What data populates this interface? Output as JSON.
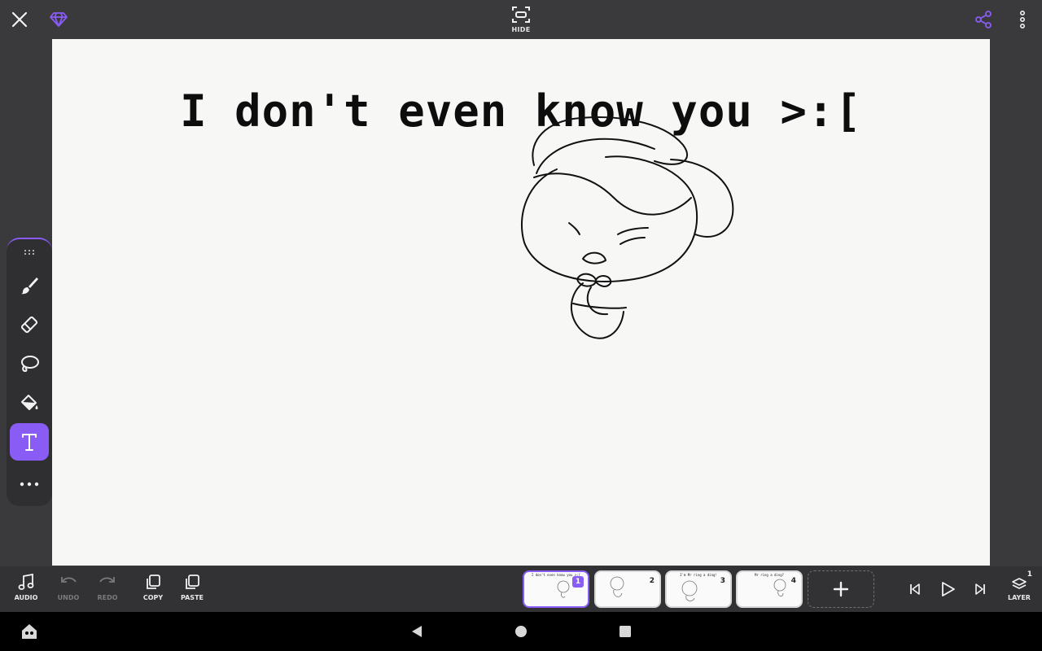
{
  "topbar": {
    "hide_label": "HIDE",
    "accent_color": "#8a5cf6"
  },
  "canvas": {
    "text": "I don't even know you >:["
  },
  "tools": {
    "items": [
      {
        "name": "brush",
        "icon": "brush-icon",
        "active": false
      },
      {
        "name": "eraser",
        "icon": "eraser-icon",
        "active": false
      },
      {
        "name": "lasso",
        "icon": "lasso-icon",
        "active": false
      },
      {
        "name": "fill",
        "icon": "fill-bucket-icon",
        "active": false
      },
      {
        "name": "text",
        "icon": "text-tool-icon",
        "active": true
      },
      {
        "name": "more",
        "icon": "more-horizontal-icon",
        "active": false
      }
    ]
  },
  "bottombar": {
    "audio_label": "AUDIO",
    "undo_label": "UNDO",
    "redo_label": "REDO",
    "copy_label": "COPY",
    "paste_label": "PASTE",
    "layer_label": "LAYER",
    "layer_count": "1",
    "frames": [
      {
        "number": "1",
        "title": "I don't even know you >:[",
        "selected": true
      },
      {
        "number": "2",
        "title": "",
        "selected": false
      },
      {
        "number": "3",
        "title": "I'm Mr ring a ding!",
        "selected": false
      },
      {
        "number": "4",
        "title": "Mr ring a ding?",
        "selected": false
      }
    ]
  }
}
